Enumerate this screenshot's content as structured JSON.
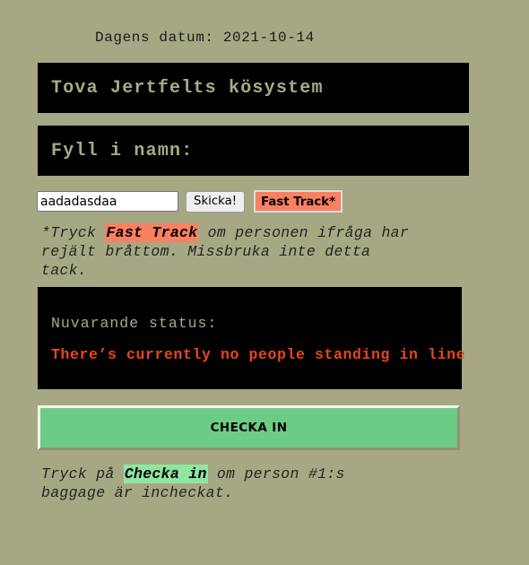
{
  "page": {
    "background_color": "#a6a884",
    "date_line": "Dagens datum: 2021-10-14"
  },
  "header": {
    "title": "Tova Jertfelts kösystem",
    "subtitle": "Fyll i namn:"
  },
  "form": {
    "name_input_value": "aadadasdaa",
    "name_input_placeholder": "",
    "submit_label": "Skicka!",
    "fast_track_label": "Fast Track*",
    "fast_track_color": "#fa8062"
  },
  "notes": {
    "fast_track": {
      "before": "*Tryck ",
      "highlight": "Fast Track",
      "after": " om personen ifråga har rejält bråttom. Missbruka inte detta tack.",
      "highlight_color": "#fa8062"
    },
    "check_in": {
      "before": "Tryck på ",
      "highlight": "Checka in",
      "after": " om person #1:s baggage är incheckat.",
      "highlight_color": "#8fe6a0"
    }
  },
  "status": {
    "label": "Nuvarande status:",
    "message": "There’s currently no people standing in line",
    "message_color": "#e8461e",
    "label_color": "#a8aa85",
    "panel_color": "#000000"
  },
  "actions": {
    "check_in_label": "CHECKA IN",
    "check_in_color": "#6ccc85"
  }
}
